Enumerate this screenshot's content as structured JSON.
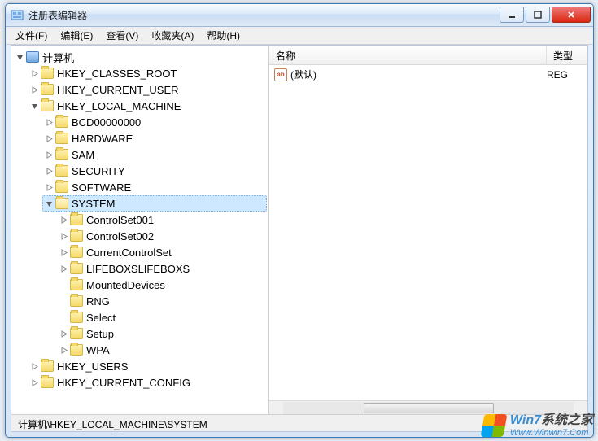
{
  "window": {
    "title": "注册表编辑器"
  },
  "menu": {
    "file": "文件(F)",
    "edit": "编辑(E)",
    "view": "查看(V)",
    "fav": "收藏夹(A)",
    "help": "帮助(H)"
  },
  "tree": {
    "root": "计算机",
    "hives": {
      "hkcr": "HKEY_CLASSES_ROOT",
      "hkcu": "HKEY_CURRENT_USER",
      "hklm": "HKEY_LOCAL_MACHINE",
      "hku": "HKEY_USERS",
      "hkcc": "HKEY_CURRENT_CONFIG"
    },
    "hklm_children": {
      "bcd": "BCD00000000",
      "hw": "HARDWARE",
      "sam": "SAM",
      "sec": "SECURITY",
      "sw": "SOFTWARE",
      "sys": "SYSTEM"
    },
    "system_children": {
      "cs1": "ControlSet001",
      "cs2": "ControlSet002",
      "ccs": "CurrentControlSet",
      "life": "LIFEBOXSLIFEBOXS",
      "md": "MountedDevices",
      "rng": "RNG",
      "sel": "Select",
      "setup": "Setup",
      "wpa": "WPA"
    }
  },
  "list": {
    "col_name": "名称",
    "col_type": "类型",
    "row0_name": "(默认)",
    "row0_type": "REG"
  },
  "status": {
    "path": "计算机\\HKEY_LOCAL_MACHINE\\SYSTEM"
  },
  "watermark": {
    "line1a": "Win7",
    "line1b": "系统之家",
    "line2": "Www.Winwin7.Com"
  }
}
